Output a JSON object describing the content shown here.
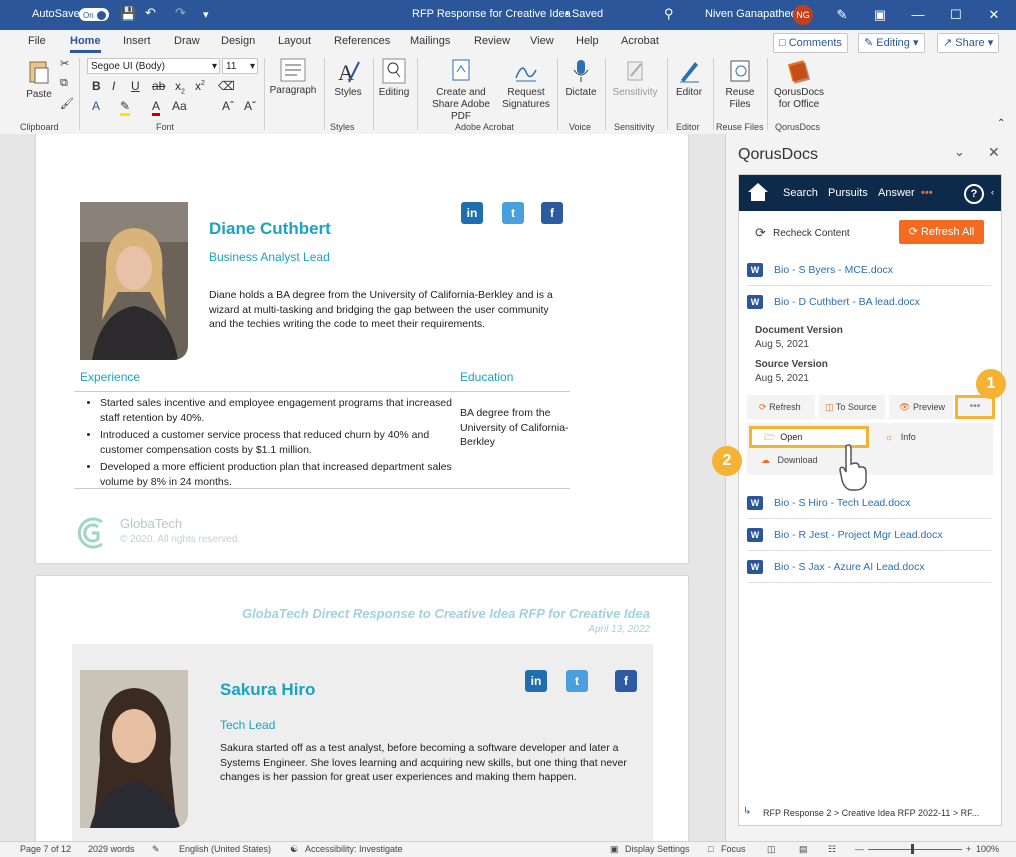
{
  "titlebar": {
    "autosave_label": "AutoSave",
    "autosave_state": "On",
    "doc_title": "RFP Response for Creative Idea",
    "saved": "• Saved",
    "user_name": "Niven Ganapathee",
    "user_initials": "NG"
  },
  "menu": {
    "tabs": [
      "File",
      "Home",
      "Insert",
      "Draw",
      "Design",
      "Layout",
      "References",
      "Mailings",
      "Review",
      "View",
      "Help",
      "Acrobat"
    ],
    "comments": "Comments",
    "editing": "Editing",
    "share": "Share"
  },
  "ribbon": {
    "paste": "Paste",
    "font_name": "Segoe UI (Body)",
    "font_size": "11",
    "paragraph": "Paragraph",
    "styles": "Styles",
    "editing": "Editing",
    "create_share": "Create and Share Adobe PDF",
    "request_sig": "Request Signatures",
    "dictate": "Dictate",
    "sensitivity": "Sensitivity",
    "editor": "Editor",
    "reuse_files": "Reuse Files",
    "qorus": "QorusDocs for Office",
    "groups": {
      "clipboard": "Clipboard",
      "font": "Font",
      "styles": "Styles",
      "acrobat": "Adobe Acrobat",
      "voice": "Voice",
      "sensitivity": "Sensitivity",
      "editor": "Editor",
      "reuse": "Reuse Files",
      "qorus": "QorusDocs"
    }
  },
  "page1": {
    "name": "Diane Cuthbert",
    "role": "Business Analyst Lead",
    "bio": "Diane holds a BA degree from the University of California-Berkley and is a wizard at multi-tasking and bridging the gap between the user community and the techies writing the code to meet their requirements.",
    "experience_title": "Experience",
    "education_title": "Education",
    "experience": [
      "Started sales incentive and employee engagement programs that increased staff retention by 40%.",
      "Introduced a customer service process that reduced churn by 40% and customer compensation costs by $1.1 million.",
      "Developed a more efficient production plan that increased department sales volume by 8% in 24 months."
    ],
    "education": "BA degree from the University of California-Berkley",
    "company": "GlobaTech",
    "copyright": "© 2020. All rights reserved."
  },
  "page2": {
    "header": "GlobaTech Direct Response to Creative Idea RFP for Creative Idea",
    "date": "April 13, 2022",
    "name": "Sakura Hiro",
    "role": "Tech Lead",
    "bio": "Sakura started off as a test analyst, before becoming a software developer and later a Systems Engineer. She loves learning and acquiring new skills, but one thing that never changes is her passion for great user experiences and making them happen."
  },
  "social": {
    "linkedin": "in",
    "twitter": "t",
    "facebook": "f"
  },
  "pane": {
    "title": "QorusDocs",
    "nav": {
      "search": "Search",
      "pursuits": "Pursuits",
      "answer": "Answer",
      "help": "?"
    },
    "recheck": "Recheck Content",
    "refresh_all": "Refresh All",
    "docs_top": [
      "Bio - S Byers - MCE.docx",
      "Bio - D Cuthbert - BA lead.docx"
    ],
    "doc_version_label": "Document Version",
    "doc_version_date": "Aug 5, 2021",
    "source_version_label": "Source Version",
    "source_version_date": "Aug 5, 2021",
    "actions": {
      "refresh": "Refresh",
      "to_source": "To Source",
      "preview": "Preview",
      "more": "•••"
    },
    "menu": {
      "open": "Open",
      "info": "Info",
      "download": "Download"
    },
    "docs_bottom": [
      "Bio - S Hiro - Tech Lead.docx",
      "Bio - R Jest - Project Mgr Lead.docx",
      "Bio - S Jax - Azure AI Lead.docx"
    ],
    "breadcrumb": "RFP Response 2 > Creative Idea RFP 2022-11 > RF..."
  },
  "callouts": {
    "one": "1",
    "two": "2"
  },
  "status": {
    "page": "Page 7 of 12",
    "words": "2029 words",
    "language": "English (United States)",
    "accessibility": "Accessibility: Investigate",
    "display": "Display Settings",
    "focus": "Focus",
    "zoom": "100%"
  },
  "colors": {
    "word_blue": "#2b579a",
    "accent": "#1aa3c5",
    "qorus_nav": "#0d2a4a",
    "orange": "#f26b21",
    "callout": "#f5b335"
  }
}
